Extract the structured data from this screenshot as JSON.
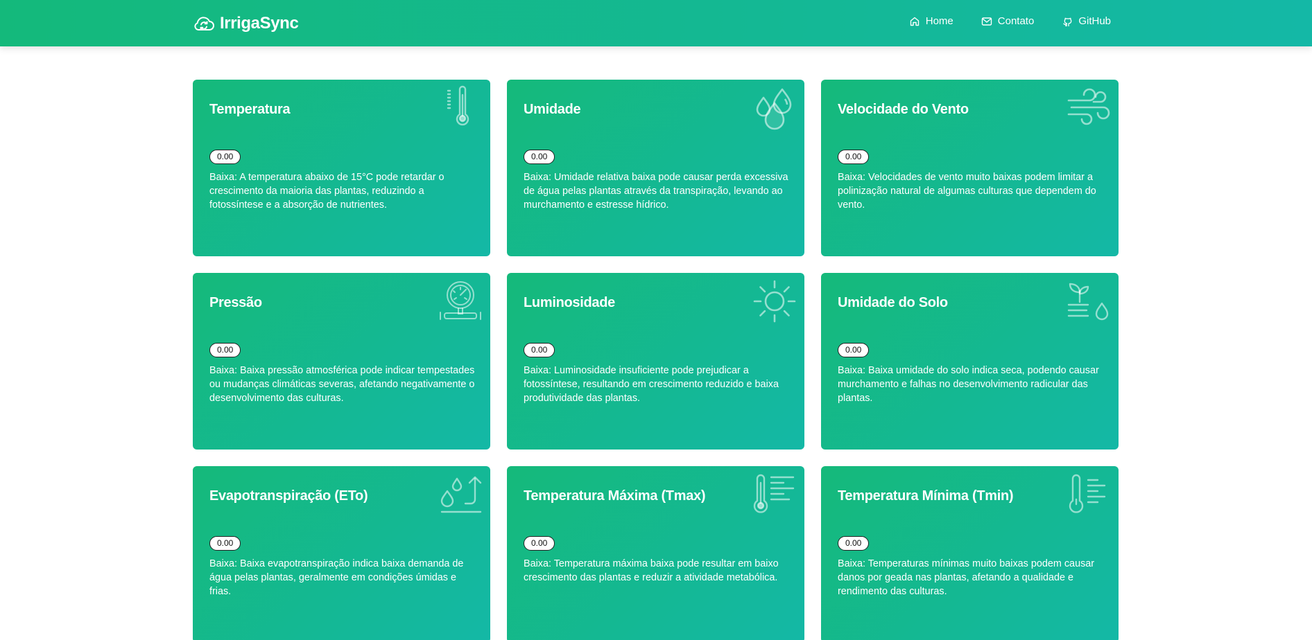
{
  "header": {
    "brand": "IrrigaSync",
    "nav": [
      {
        "label": "Home",
        "icon": "home-icon"
      },
      {
        "label": "Contato",
        "icon": "mail-icon"
      },
      {
        "label": "GitHub",
        "icon": "github-icon"
      }
    ]
  },
  "theme": {
    "gradient_start": "#15b97a",
    "gradient_end": "#14b8a6",
    "text": "#ffffff"
  },
  "cards": [
    {
      "title": "Temperatura",
      "value": "0.00",
      "description": "Baixa: A temperatura abaixo de 15°C pode retardar o crescimento da maioria das plantas, reduzindo a fotossíntese e a absorção de nutrientes.",
      "icon": "thermometer-icon"
    },
    {
      "title": "Umidade",
      "value": "0.00",
      "description": "Baixa: Umidade relativa baixa pode causar perda excessiva de água pelas plantas através da transpiração, levando ao murchamento e estresse hídrico.",
      "icon": "droplets-icon"
    },
    {
      "title": "Velocidade do Vento",
      "value": "0.00",
      "description": "Baixa: Velocidades de vento muito baixas podem limitar a polinização natural de algumas culturas que dependem do vento.",
      "icon": "wind-icon"
    },
    {
      "title": "Pressão",
      "value": "0.00",
      "description": "Baixa: Baixa pressão atmosférica pode indicar tempestades ou mudanças climáticas severas, afetando negativamente o desenvolvimento das culturas.",
      "icon": "pressure-gauge-icon"
    },
    {
      "title": "Luminosidade",
      "value": "0.00",
      "description": "Baixa: Luminosidade insuficiente pode prejudicar a fotossíntese, resultando em crescimento reduzido e baixa produtividade das plantas.",
      "icon": "sun-icon"
    },
    {
      "title": "Umidade do Solo",
      "value": "0.00",
      "description": "Baixa: Baixa umidade do solo indica seca, podendo causar murchamento e falhas no desenvolvimento radicular das plantas.",
      "icon": "sprout-drop-icon"
    },
    {
      "title": "Evapotranspiração (ETo)",
      "value": "0.00",
      "description": "Baixa: Baixa evapotranspiração indica baixa demanda de água pelas plantas, geralmente em condições úmidas e frias.",
      "icon": "evaporation-icon"
    },
    {
      "title": "Temperatura Máxima (Tmax)",
      "value": "0.00",
      "description": "Baixa: Temperatura máxima baixa pode resultar em baixo crescimento das plantas e reduzir a atividade metabólica.",
      "icon": "thermometer-high-icon"
    },
    {
      "title": "Temperatura Mínima (Tmin)",
      "value": "0.00",
      "description": "Baixa: Temperaturas mínimas muito baixas podem causar danos por geada nas plantas, afetando a qualidade e rendimento das culturas.",
      "icon": "thermometer-low-icon"
    }
  ]
}
